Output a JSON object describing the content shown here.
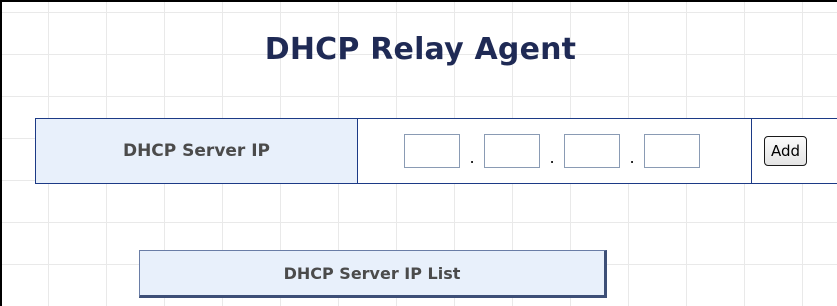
{
  "page": {
    "title": "DHCP Relay Agent"
  },
  "server_ip_form": {
    "label": "DHCP Server IP",
    "octets": [
      "",
      "",
      "",
      ""
    ],
    "separator": ".",
    "add_label": "Add"
  },
  "server_ip_list": {
    "header": "DHCP Server IP List"
  },
  "colors": {
    "title": "#1f2a55",
    "label_background": "#e8f0fb",
    "border": "#1c3a86",
    "label_text": "#4b4b4b"
  }
}
